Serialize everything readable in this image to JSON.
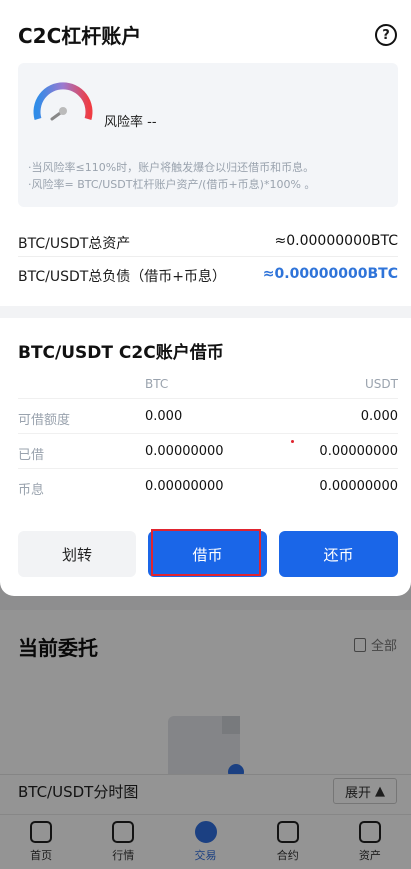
{
  "modal": {
    "title": "C2C杠杆账户",
    "help_icon": "help-icon",
    "risk": {
      "label": "风险率 --",
      "note_line1": "·当风险率≤110%时，账户将触发爆仓以归还借币和币息。",
      "note_line2": "·风险率= BTC/USDT杠杆账户资产/(借币+币息)*100% 。"
    },
    "summary": [
      {
        "label": "BTC/USDT总资产",
        "value": "≈0.00000000BTC"
      },
      {
        "label": "BTC/USDT总负债（借币+币息）",
        "value": "≈0.00000000BTC"
      }
    ],
    "borrow": {
      "title": "BTC/USDT C2C账户借币",
      "col_btc": "BTC",
      "col_usdt": "USDT",
      "rows": [
        {
          "label": "可借额度",
          "btc": "0.000",
          "usdt": "0.000"
        },
        {
          "label": "已借",
          "btc": "0.00000000",
          "usdt": "0.00000000"
        },
        {
          "label": "币息",
          "btc": "0.00000000",
          "usdt": "0.00000000"
        }
      ]
    },
    "buttons": {
      "transfer": "划转",
      "borrow": "借币",
      "repay": "还币"
    }
  },
  "background": {
    "orders_title": "当前委托",
    "all_label": "全部",
    "chart_title": "BTC/USDT分时图",
    "expand_label": "展开",
    "nav": [
      {
        "label": "首页",
        "icon": "home-icon"
      },
      {
        "label": "行情",
        "icon": "market-icon"
      },
      {
        "label": "交易",
        "icon": "trade-icon"
      },
      {
        "label": "合约",
        "icon": "contract-icon"
      },
      {
        "label": "资产",
        "icon": "wallet-icon"
      }
    ]
  },
  "colors": {
    "accent": "#1a66e8",
    "highlight": "#e0242f",
    "value_blue": "#2f74d9"
  }
}
